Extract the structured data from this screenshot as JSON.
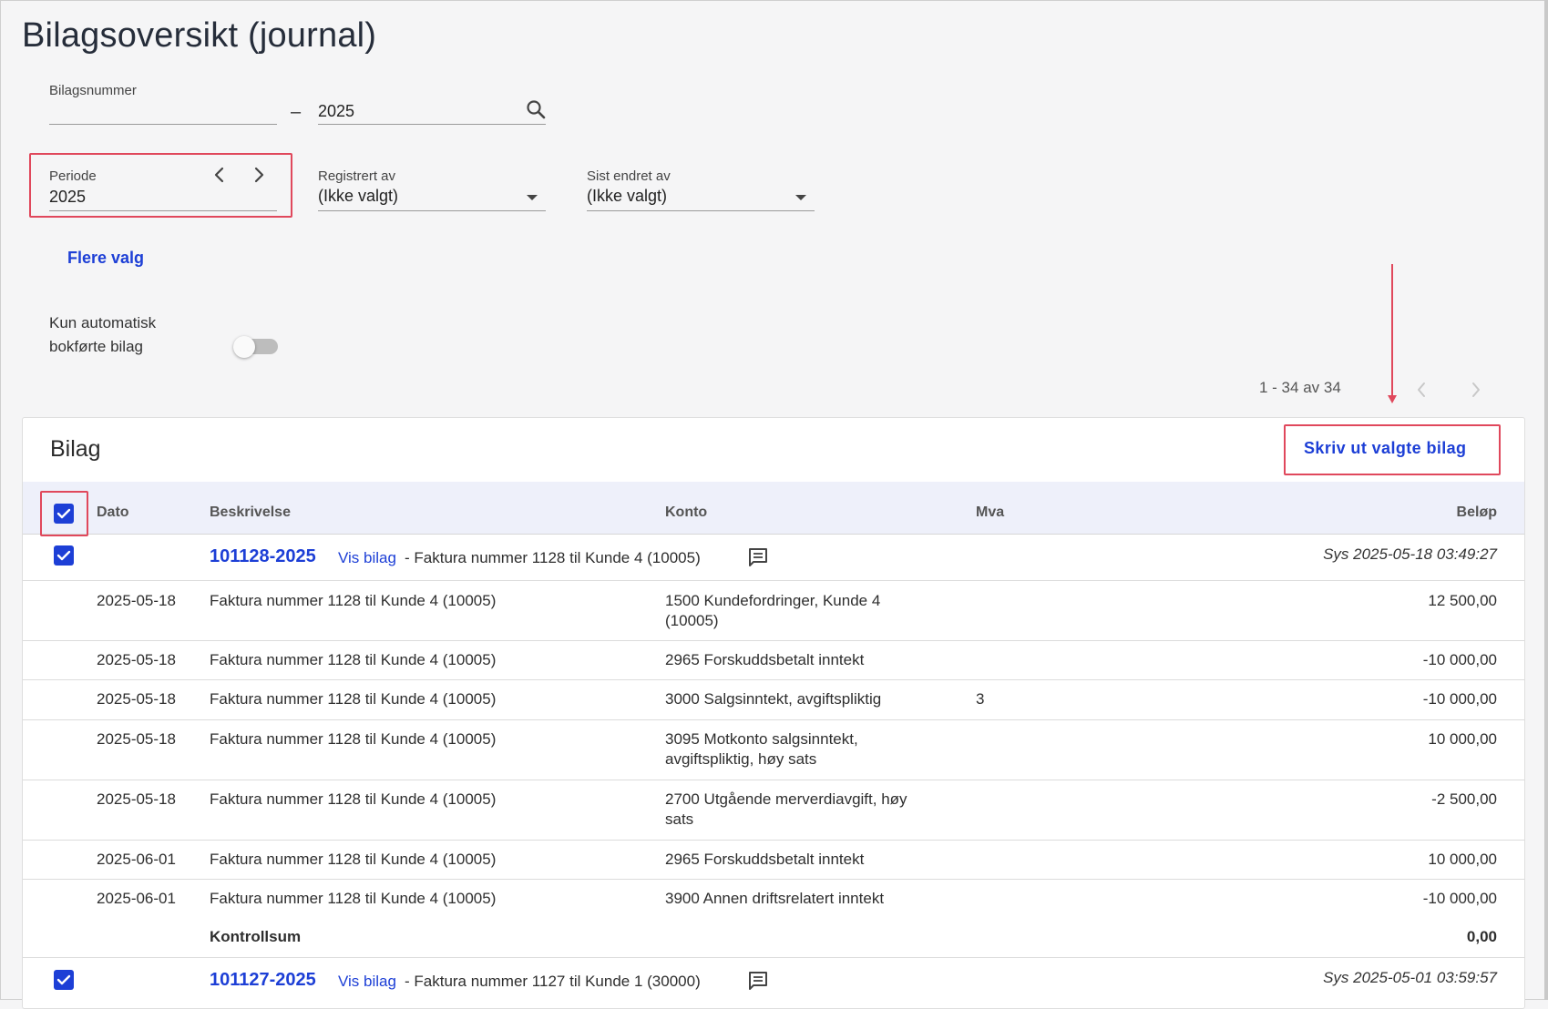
{
  "page": {
    "title": "Bilagsoversikt (journal)"
  },
  "filters": {
    "bilagsnummer": {
      "label": "Bilagsnummer",
      "from": "",
      "separator": "–",
      "to": "2025"
    },
    "periode": {
      "label": "Periode",
      "value": "2025"
    },
    "registrert_av": {
      "label": "Registrert av",
      "value": "(Ikke valgt)"
    },
    "sist_endret_av": {
      "label": "Sist endret av",
      "value": "(Ikke valgt)"
    },
    "flere_valg": "Flere valg",
    "auto_toggle": {
      "label": "Kun automatisk bokførte bilag",
      "on": false
    }
  },
  "pager": {
    "text": "1 - 34 av 34"
  },
  "panel": {
    "title": "Bilag",
    "print_button": "Skriv ut valgte bilag",
    "columns": {
      "dato": "Dato",
      "beskrivelse": "Beskrivelse",
      "konto": "Konto",
      "mva": "Mva",
      "belop": "Beløp"
    }
  },
  "vouchers": [
    {
      "number": "101128-2025",
      "link": "Vis bilag",
      "desc": "- Faktura nummer 1128 til Kunde 4 (10005)",
      "sys": "Sys 2025-05-18 03:49:27",
      "checked": true,
      "lines": [
        {
          "dato": "2025-05-18",
          "beskrivelse": "Faktura nummer 1128 til Kunde 4 (10005)",
          "konto": "1500 Kundefordringer, Kunde 4 (10005)",
          "mva": "",
          "belop": "12 500,00"
        },
        {
          "dato": "2025-05-18",
          "beskrivelse": "Faktura nummer 1128 til Kunde 4 (10005)",
          "konto": "2965 Forskuddsbetalt inntekt",
          "mva": "",
          "belop": "-10 000,00"
        },
        {
          "dato": "2025-05-18",
          "beskrivelse": "Faktura nummer 1128 til Kunde 4 (10005)",
          "konto": "3000 Salgsinntekt, avgiftspliktig",
          "mva": "3",
          "belop": "-10 000,00"
        },
        {
          "dato": "2025-05-18",
          "beskrivelse": "Faktura nummer 1128 til Kunde 4 (10005)",
          "konto": "3095 Motkonto salgsinntekt, avgiftspliktig, høy sats",
          "mva": "",
          "belop": "10 000,00"
        },
        {
          "dato": "2025-05-18",
          "beskrivelse": "Faktura nummer 1128 til Kunde 4 (10005)",
          "konto": "2700 Utgående merverdiavgift, høy sats",
          "mva": "",
          "belop": "-2 500,00"
        },
        {
          "dato": "2025-06-01",
          "beskrivelse": "Faktura nummer 1128 til Kunde 4 (10005)",
          "konto": "2965 Forskuddsbetalt inntekt",
          "mva": "",
          "belop": "10 000,00"
        },
        {
          "dato": "2025-06-01",
          "beskrivelse": "Faktura nummer 1128 til Kunde 4 (10005)",
          "konto": "3900 Annen driftsrelatert inntekt",
          "mva": "",
          "belop": "-10 000,00"
        }
      ],
      "kontrollsum": {
        "label": "Kontrollsum",
        "value": "0,00"
      }
    },
    {
      "number": "101127-2025",
      "link": "Vis bilag",
      "desc": "- Faktura nummer 1127 til Kunde 1 (30000)",
      "sys": "Sys 2025-05-01 03:59:57",
      "checked": true
    }
  ],
  "icons": {
    "search": "search-icon",
    "prev": "chevron-left-icon",
    "next": "chevron-right-icon",
    "dropdown": "caret-down-icon",
    "comment": "comment-icon",
    "check": "checkmark-icon"
  },
  "colors": {
    "accent": "#1d3fd6",
    "highlight": "#e0485c",
    "header_bg": "#eef0fa",
    "page_bg": "#f5f5f6"
  }
}
